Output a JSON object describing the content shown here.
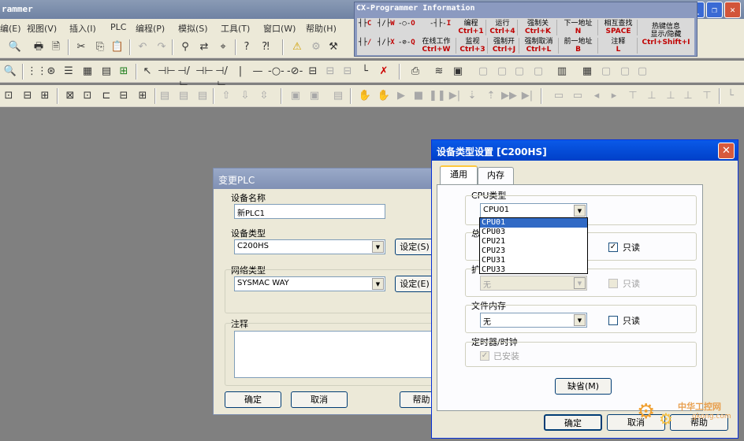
{
  "main": {
    "title": "rammer",
    "menu": [
      "编(E)",
      "视图(V)",
      "插入(I)",
      "PLC",
      "编程(P)",
      "模拟(S)",
      "工具(T)",
      "窗口(W)",
      "帮助(H)"
    ]
  },
  "info_panel": {
    "title": "CX-Programmer Information",
    "ladder_row1": [
      {
        "sym": "┤├",
        "key": "C"
      },
      {
        "sym": "┤/├",
        "key": "W"
      },
      {
        "sym": "-○-",
        "key": "O"
      },
      {
        "sym": "-┤├-",
        "key": "I"
      }
    ],
    "ladder_row2": [
      {
        "sym": "┤├",
        "key": "/"
      },
      {
        "sym": "┤/├",
        "key": "X"
      },
      {
        "sym": "-⊘-",
        "key": "Q"
      }
    ],
    "cells_row1": [
      {
        "label": "编程",
        "key": "Ctrl+1"
      },
      {
        "label": "运行",
        "key": "Ctrl+4"
      },
      {
        "label": "强制关",
        "key": "Ctrl+K"
      },
      {
        "label": "下一地址",
        "key": "N"
      },
      {
        "label": "相互查找",
        "key": "SPACE"
      }
    ],
    "cells_row2": [
      {
        "label": "在线工作",
        "key": "Ctrl+W"
      },
      {
        "label": "监视",
        "key": "Ctrl+3"
      },
      {
        "label": "强制开",
        "key": "Ctrl+J"
      },
      {
        "label": "强制取消",
        "key": "Ctrl+L"
      },
      {
        "label": "前一地址",
        "key": "B"
      },
      {
        "label": "注释",
        "key": "L"
      }
    ],
    "hotkey_cell": {
      "label1": "热键信息",
      "label2": "显示/隐藏",
      "key": "Ctrl+Shift+I"
    }
  },
  "change_plc": {
    "title": "变更PLC",
    "device_name_label": "设备名称",
    "device_name_value": "新PLC1",
    "device_type_label": "设备类型",
    "device_type_value": "C200HS",
    "settings_button_1": "设定(S)",
    "network_type_label": "网络类型",
    "network_type_value": "SYSMAC WAY",
    "settings_button_2": "设定(E)",
    "comment_label": "注释",
    "ok_button": "确定",
    "cancel_button": "取消",
    "help_button": "帮助"
  },
  "device_type_dialog": {
    "title": "设备类型设置 [C200HS]",
    "tabs": [
      "通用",
      "内存"
    ],
    "cpu_type_label": "CPU类型",
    "cpu_type_value": "CPU01",
    "cpu_options": [
      "CPU01",
      "CPU03",
      "CPU21",
      "CPU23",
      "CPU31",
      "CPU33"
    ],
    "total_group_label": "总",
    "readonly_1": "只读",
    "expansion_group_label": "扩",
    "expansion_value": "无",
    "readonly_2": "只读",
    "file_memory_label": "文件内存",
    "file_memory_value": "无",
    "readonly_3": "只读",
    "timer_label": "定时器/时钟",
    "installed_label": "已安装",
    "default_button": "缺省(M)",
    "ok_button": "确定",
    "cancel_button": "取消",
    "help_button": "帮助"
  },
  "watermark": {
    "text": "中华工控网",
    "url": "gkong.com"
  }
}
